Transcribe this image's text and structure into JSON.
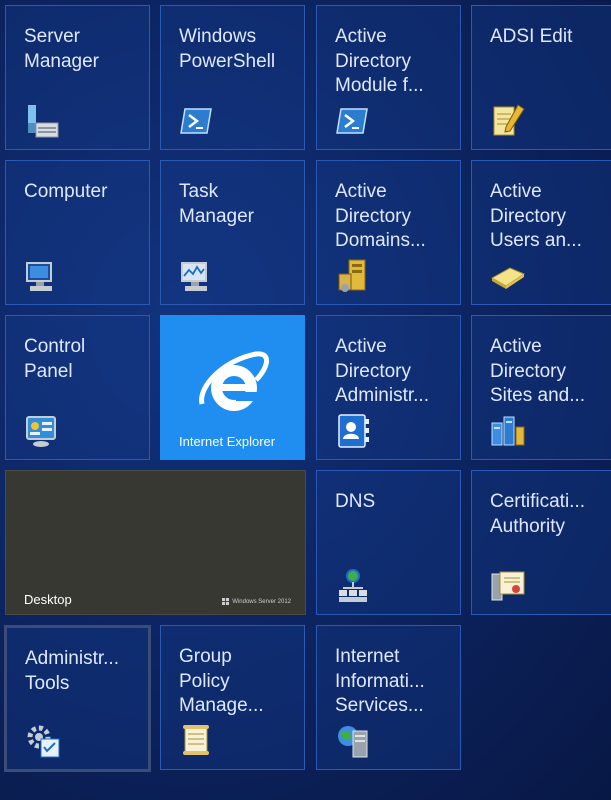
{
  "tiles": {
    "server_manager": "Server\nManager",
    "windows_powershell": "Windows\nPowerShell",
    "ad_module": "Active\nDirectory\nModule f...",
    "adsi_edit": "ADSI Edit",
    "computer": "Computer",
    "task_manager": "Task\nManager",
    "ad_domains": "Active\nDirectory\nDomains...",
    "ad_users": "Active\nDirectory\nUsers an...",
    "control_panel": "Control\nPanel",
    "internet_explorer": "Internet Explorer",
    "ad_admin": "Active\nDirectory\nAdministr...",
    "ad_sites": "Active\nDirectory\nSites and...",
    "desktop": "Desktop",
    "desktop_brand": "Windows Server 2012",
    "dns": "DNS",
    "cert_authority": "Certificati...\nAuthority",
    "admin_tools": "Administr...\nTools",
    "group_policy": "Group\nPolicy\nManage...",
    "iis": "Internet\nInformati...\nServices..."
  },
  "colors": {
    "background": "#0d2563",
    "tile_border": "#2a5ab5",
    "ie_tile": "#1f8ef0",
    "desktop_tile": "#373832"
  }
}
